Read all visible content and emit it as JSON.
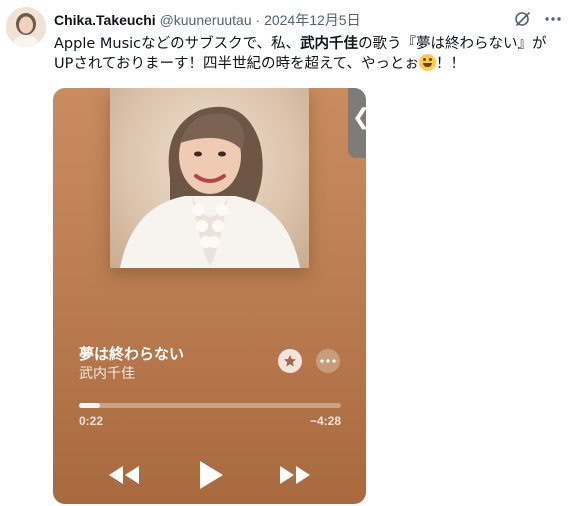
{
  "tweet": {
    "display_name": "Chika.Takeuchi",
    "handle": "@kuuneruutau",
    "separator": "·",
    "date": "2024年12月5日",
    "text_part1": "Apple Musicなどのサブスクで、私、",
    "text_bold": "武内千佳",
    "text_part2": "の歌う『夢は終わらない』が",
    "text_line2": "UPされておりまーす！四半世紀の時を超えて、やっとぉ",
    "text_tail": "！！",
    "icons": [
      "avatar-photo",
      "grok-icon",
      "more-icon",
      "laughing-emoji"
    ]
  },
  "player": {
    "song_title": "夢は終わらない",
    "artist": "武内千佳",
    "time_elapsed": "0:22",
    "time_remaining": "−4:28",
    "progress": 0.08,
    "side_tab_glyph": "❮",
    "icons": [
      "album-cover",
      "star-icon",
      "more-icon",
      "rewind-icon",
      "play-icon",
      "fast-forward-icon"
    ]
  },
  "colors": {
    "player_top": "#c88c60",
    "player_bottom": "#a8693f",
    "text_primary": "#0f1419",
    "text_secondary": "#536471"
  }
}
